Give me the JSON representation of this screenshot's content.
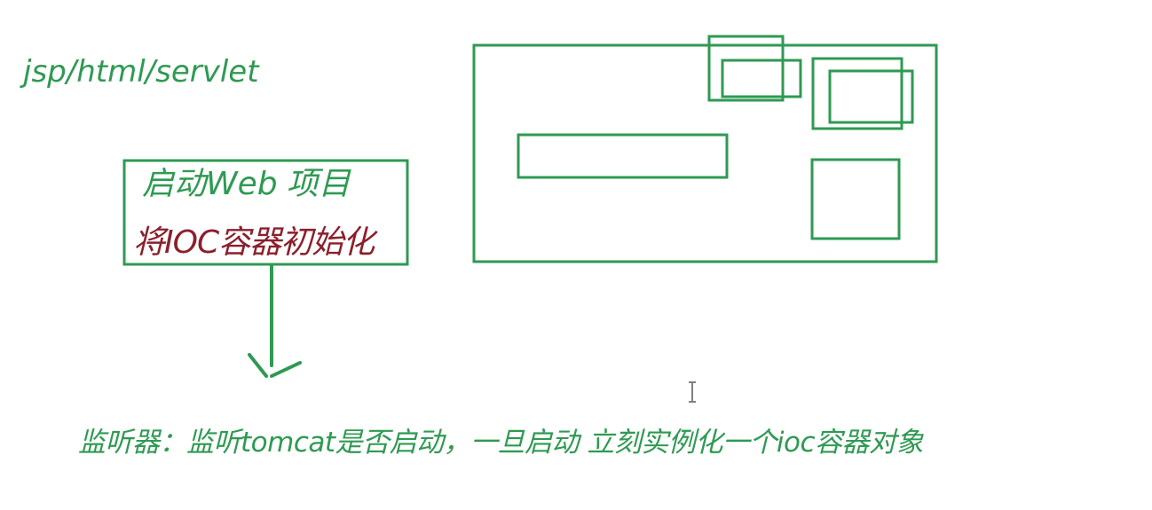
{
  "texts": {
    "top_left_label": "jsp/html/servlet",
    "box_line_1": "启动Web",
    "box_line_1_suffix": "项目",
    "box_line_2": "将IOC容器初始化",
    "bottom_caption": "监听器：监听tomcat是否启动，一旦启动 立刻实例化一个ioc容器对象"
  },
  "colors": {
    "stroke_green": "#2e9a52",
    "text_green": "#2e9a52",
    "text_darkred": "#8c1f2b"
  },
  "icons": {
    "cursor": "text-cursor-ibeam"
  }
}
